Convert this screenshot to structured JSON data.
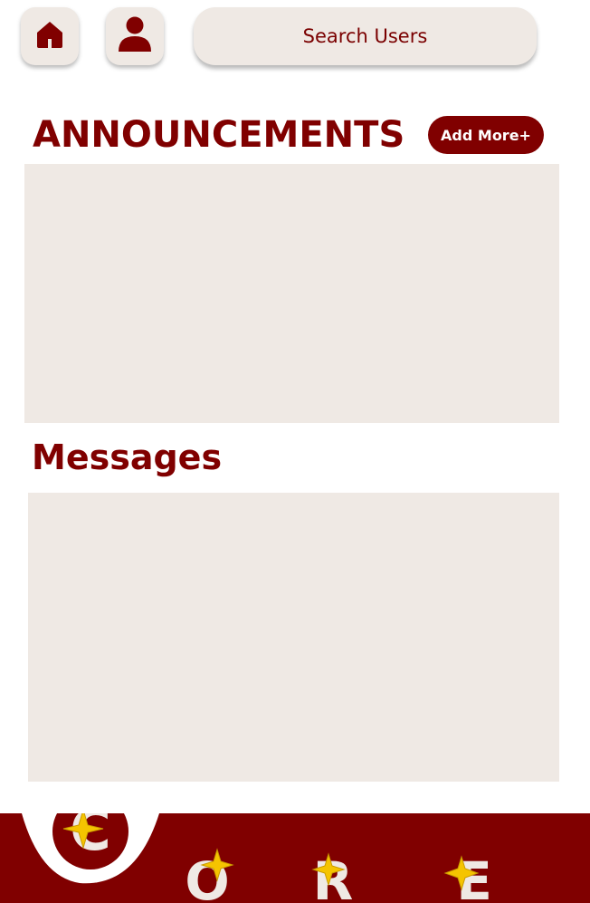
{
  "header": {
    "home_icon": "home-icon",
    "profile_icon": "user-icon",
    "search_placeholder": "Search Users"
  },
  "announcements": {
    "title": "ANNOUNCEMENTS",
    "add_label": "Add More+"
  },
  "messages": {
    "title": "Messages"
  },
  "footer": {
    "letters": [
      "C",
      "O",
      "R",
      "E"
    ]
  },
  "colors": {
    "primary": "#800000",
    "panel": "#efe9e4",
    "star": "#f5c400"
  }
}
